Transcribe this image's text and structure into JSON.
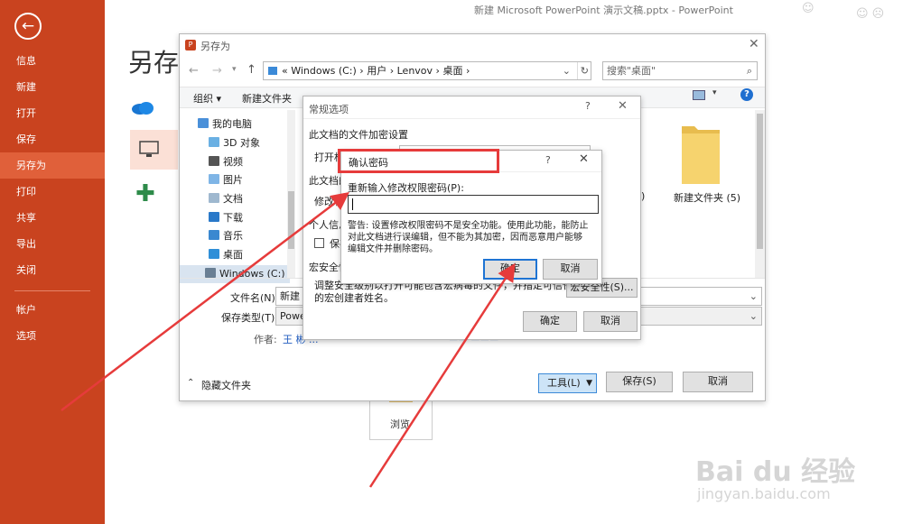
{
  "app_title": "新建 Microsoft PowerPoint 演示文稿.pptx - PowerPoint",
  "backstage": {
    "items": [
      "信息",
      "新建",
      "打开",
      "保存",
      "另存为",
      "打印",
      "共享",
      "导出",
      "关闭"
    ],
    "bottom_items": [
      "帐户",
      "选项"
    ],
    "selected": "另存为",
    "page_title": "另存",
    "browse_label": "浏览"
  },
  "save_as": {
    "title": "另存为",
    "path": [
      "Windows (C:)",
      "用户",
      "Lenvov",
      "桌面"
    ],
    "path_prefix": "«",
    "search_placeholder": "搜索\"桌面\"",
    "organize_label": "组织 ▾",
    "new_folder_label": "新建文件夹",
    "tree": [
      "我的电脑",
      "3D 对象",
      "视频",
      "图片",
      "文档",
      "下载",
      "音乐",
      "桌面",
      "Windows (C:)"
    ],
    "folder_item": "新建文件夹 (5)",
    "folder_item_partial": "4)",
    "filename_label": "文件名(N):",
    "filename_value": "新建 M",
    "filetype_label": "保存类型(T):",
    "filetype_value": "Powe",
    "author_label": "作者:",
    "author_value": "王 彬 ...",
    "hide_folders": "隐藏文件夹",
    "tools_label": "工具(L)",
    "save_label": "保存(S)",
    "cancel_label": "取消"
  },
  "general_options": {
    "title": "常规选项",
    "help": "?",
    "section1": "此文档的文件加密设置",
    "open_pw_label": "打开权",
    "section2": "此文档的",
    "modify_pw_label": "修改权",
    "privacy_label": "个人信息",
    "save_checkbox": "保存",
    "macro_section": "宏安全性",
    "macro_desc_1": "调整安全级别以打开可能包含宏病毒的文件，并指定可信任",
    "macro_desc_2": "的宏创建者姓名。",
    "macro_button": "宏安全性(S)...",
    "ok": "确定",
    "cancel": "取消"
  },
  "confirm_password": {
    "title": "确认密码",
    "help": "?",
    "prompt": "重新输入修改权限密码(P):",
    "warning_1": "警告: 设置修改权限密码不是安全功能。使用此功能，能防止",
    "warning_2": "对此文档进行误编辑，但不能为其加密，因而恶意用户能够",
    "warning_3": "编辑文件并删除密码。",
    "ok": "确定",
    "cancel": "取消"
  },
  "watermark": {
    "brand": "Bai du 经验",
    "url": "jingyan.baidu.com"
  },
  "colors": {
    "accent": "#c9431f",
    "selected": "#e0603a",
    "annotation": "#e63b3b",
    "focus": "#1f74d3"
  }
}
